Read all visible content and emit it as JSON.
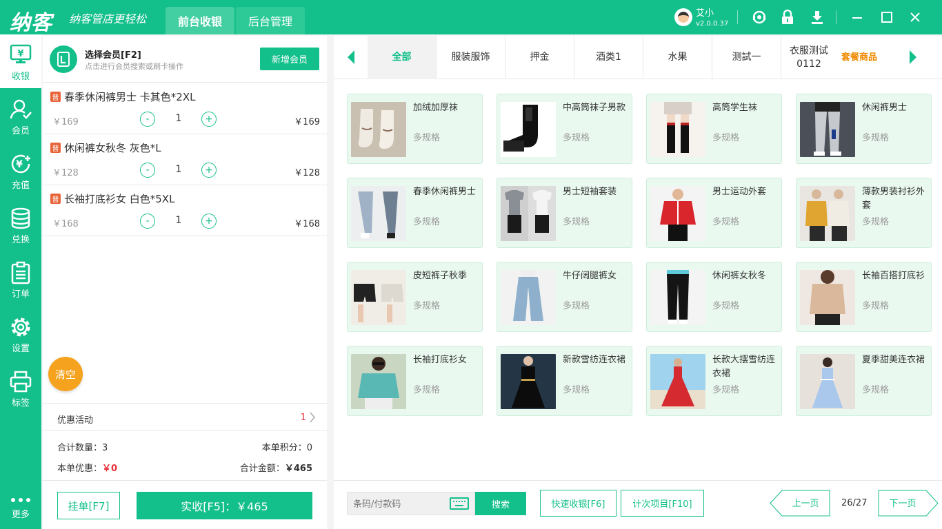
{
  "app": {
    "brand": "纳客",
    "slogan": "纳客管店更轻松",
    "tabs": [
      "前台收银",
      "后台管理"
    ],
    "user": {
      "name": "艾小",
      "version": "v2.0.0.37"
    }
  },
  "nav": [
    {
      "label": "收银",
      "icon": "cashier-icon"
    },
    {
      "label": "会员",
      "icon": "member-icon"
    },
    {
      "label": "充值",
      "icon": "recharge-icon"
    },
    {
      "label": "兑换",
      "icon": "exchange-icon"
    },
    {
      "label": "订单",
      "icon": "order-icon"
    },
    {
      "label": "设置",
      "icon": "gear-icon"
    },
    {
      "label": "标签",
      "icon": "printer-icon"
    },
    {
      "label": "更多",
      "icon": "more-icon"
    }
  ],
  "member": {
    "title": "选择会员[F2]",
    "subtitle": "点击进行会员搜索或刷卡操作",
    "add_label": "新增会员"
  },
  "cart": {
    "items": [
      {
        "badge": "普",
        "name": "春季休闲裤男士 卡其色*2XL",
        "unit": "￥169",
        "qty": "1",
        "total": "￥169"
      },
      {
        "badge": "普",
        "name": "休闲裤女秋冬 灰色*L",
        "unit": "￥128",
        "qty": "1",
        "total": "￥128"
      },
      {
        "badge": "普",
        "name": "长袖打底衫女 白色*5XL",
        "unit": "￥168",
        "qty": "1",
        "total": "￥168"
      }
    ],
    "minus": "-",
    "plus": "+",
    "clear_label": "清空",
    "promo_label": "优惠活动",
    "promo_count": "1",
    "total_qty_label": "合计数量：",
    "total_qty": "3",
    "points_label": "本单积分：",
    "points": "0",
    "discount_label": "本单优惠：",
    "discount": "￥0",
    "amount_label": "合计金额：",
    "amount": "￥465",
    "hold_label": "挂单[F7]",
    "pay_label": "实收[F5]：￥465"
  },
  "categories": [
    "全部",
    "服装服饰",
    "押金",
    "酒类1",
    "水果",
    "测試一",
    "衣服测试\n0112",
    "套餐商品"
  ],
  "products": [
    {
      "name": "加绒加厚袜",
      "spec": "多规格",
      "img": "sock"
    },
    {
      "name": "中高筒袜子男款",
      "spec": "多规格",
      "img": "sock-black"
    },
    {
      "name": "高筒学生袜",
      "spec": "多规格",
      "img": "stocking"
    },
    {
      "name": "休闲裤男士",
      "spec": "多规格",
      "img": "pants-man"
    },
    {
      "name": "春季休闲裤男士",
      "spec": "多规格",
      "img": "jeans"
    },
    {
      "name": "男士短袖套装",
      "spec": "多规格",
      "img": "tshirts"
    },
    {
      "name": "男士运动外套",
      "spec": "多规格",
      "img": "red-jacket"
    },
    {
      "name": "薄款男装衬衫外套",
      "spec": "多规格",
      "img": "shirt-jacket"
    },
    {
      "name": "皮短裤子秋季",
      "spec": "多规格",
      "img": "shorts"
    },
    {
      "name": "牛仔阔腿裤女",
      "spec": "多规格",
      "img": "wide-jeans"
    },
    {
      "name": "休闲裤女秋冬",
      "spec": "多规格",
      "img": "black-pants"
    },
    {
      "name": "长袖百搭打底衫",
      "spec": "多规格",
      "img": "sweater"
    },
    {
      "name": "长袖打底衫女",
      "spec": "多规格",
      "img": "teal-top"
    },
    {
      "name": "新款雪纺连衣裙",
      "spec": "多规格",
      "img": "black-dress"
    },
    {
      "name": "长款大摆雪纺连衣裙",
      "spec": "多规格",
      "img": "red-dress"
    },
    {
      "name": "夏季甜美连衣裙",
      "spec": "多规格",
      "img": "blue-dress"
    }
  ],
  "bottom": {
    "barcode_placeholder": "条码/付款码",
    "search_label": "搜索",
    "quick_label": "快速收银[F6]",
    "count_label": "计次项目[F10]",
    "prev_label": "上一页",
    "page": "26/27",
    "next_label": "下一页"
  },
  "colors": {
    "accent": "#13bf8a",
    "orange": "#f08a00",
    "badge": "#e8643a",
    "red": "#e8303a"
  }
}
